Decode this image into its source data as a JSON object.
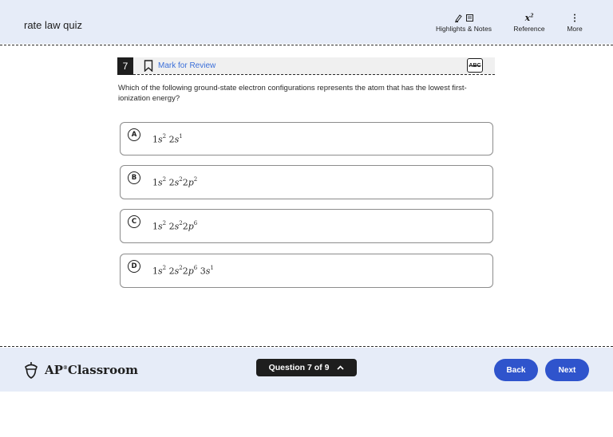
{
  "header": {
    "title": "rate law quiz",
    "tools": [
      {
        "label": "Highlights & Notes",
        "icon": "highlighter-notes-icon"
      },
      {
        "label": "Reference",
        "icon": "formula-icon"
      },
      {
        "label": "More",
        "icon": "more-vertical-icon"
      }
    ]
  },
  "question": {
    "number": "7",
    "mark_label": "Mark for Review",
    "abc_label": "ABC",
    "prompt": "Which of the following ground-state electron configurations represents the atom that has the lowest first-ionization energy?"
  },
  "options": [
    {
      "letter": "A",
      "text": "1s2 2s1"
    },
    {
      "letter": "B",
      "text": "1s2 2s22p2"
    },
    {
      "letter": "C",
      "text": "1s2 2s22p6"
    },
    {
      "letter": "D",
      "text": "1s2 2s22p6 3s1"
    }
  ],
  "footer": {
    "brand": "AP",
    "brand_suffix": "Classroom",
    "brand_mark": "®",
    "question_nav": "Question 7 of 9",
    "back_label": "Back",
    "next_label": "Next"
  },
  "colors": {
    "header_bg": "#e6ecf8",
    "accent": "#2f54cc",
    "link": "#3b6fd9"
  }
}
